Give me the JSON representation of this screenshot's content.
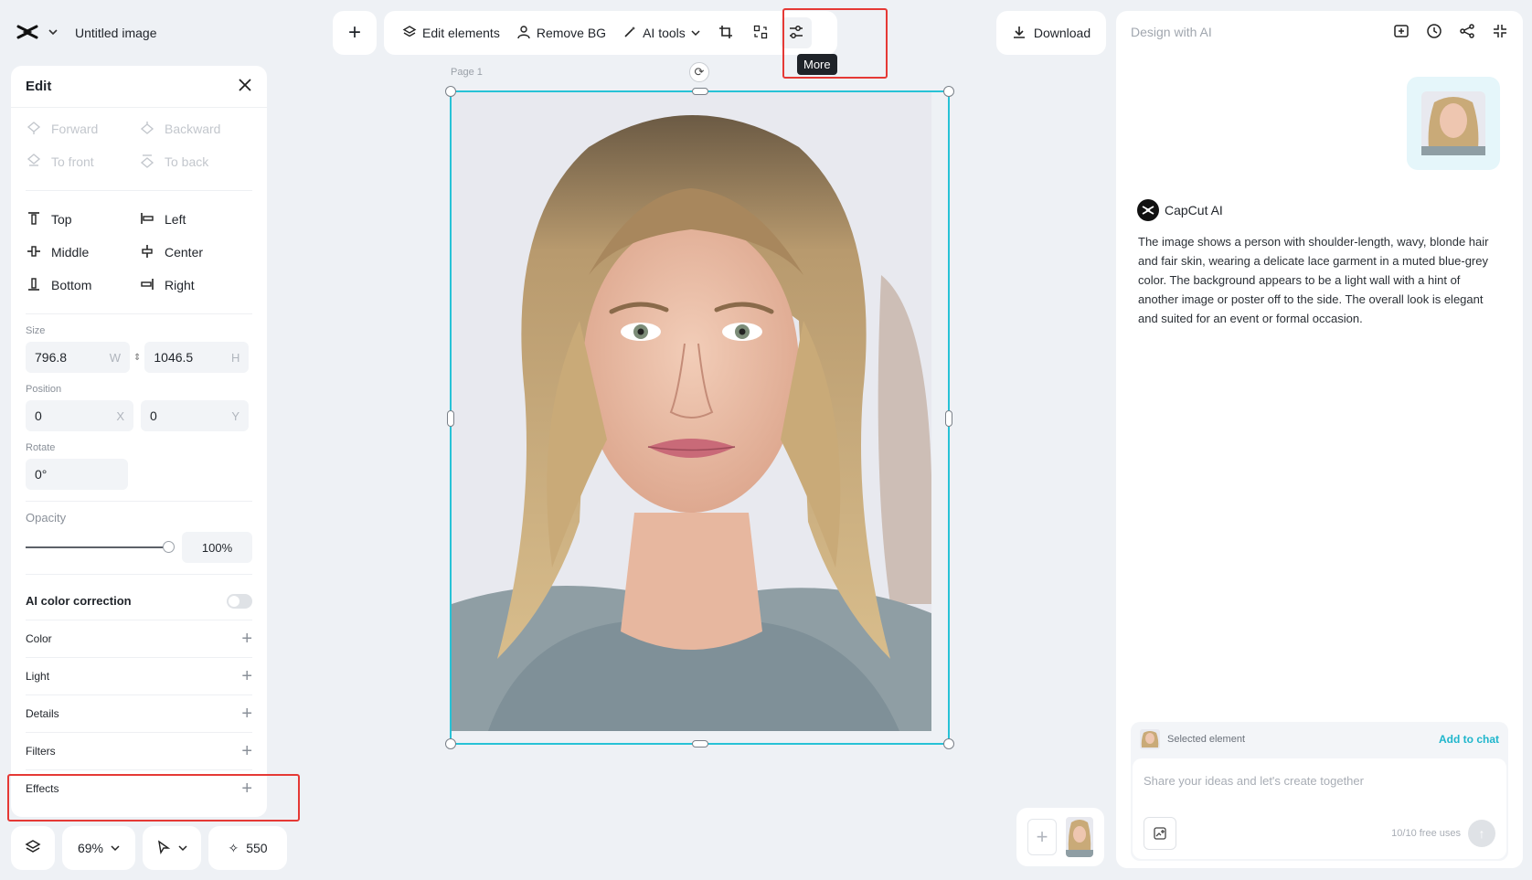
{
  "app": {
    "title": "Untitled image"
  },
  "edit_panel": {
    "title": "Edit",
    "arrange": [
      {
        "label": "Forward",
        "disabled": true
      },
      {
        "label": "Backward",
        "disabled": true
      },
      {
        "label": "To front",
        "disabled": true
      },
      {
        "label": "To back",
        "disabled": true
      }
    ],
    "align": [
      {
        "label": "Top"
      },
      {
        "label": "Left"
      },
      {
        "label": "Middle"
      },
      {
        "label": "Center"
      },
      {
        "label": "Bottom"
      },
      {
        "label": "Right"
      }
    ],
    "size_label": "Size",
    "width": "796.8",
    "width_suffix": "W",
    "height": "1046.5",
    "height_suffix": "H",
    "position_label": "Position",
    "x": "0",
    "x_suffix": "X",
    "y": "0",
    "y_suffix": "Y",
    "rotate_label": "Rotate",
    "rotate": "0°",
    "opacity_label": "Opacity",
    "opacity_value": "100%",
    "opacity_fraction": 1.0,
    "ai_color_correction": "AI color correction",
    "ai_color_correction_on": false,
    "sections": [
      "Color",
      "Light",
      "Details",
      "Filters",
      "Effects"
    ]
  },
  "bottom_bar": {
    "zoom": "69%",
    "credits": "550"
  },
  "toolbar": {
    "edit_elements": "Edit elements",
    "remove_bg": "Remove BG",
    "ai_tools": "AI tools",
    "more_tooltip": "More"
  },
  "download": "Download",
  "canvas": {
    "page_label": "Page 1"
  },
  "ai_panel": {
    "placeholder_title": "Design with AI",
    "bot_name": "CapCut AI",
    "message": "The image shows a person with shoulder-length, wavy, blonde hair and fair skin, wearing a delicate lace garment in a muted blue-grey color. The background appears to be a light wall with a hint of another image or poster off to the side. The overall look is elegant and suited for an event or formal occasion.",
    "selected_element": "Selected element",
    "add_to_chat": "Add to chat",
    "input_placeholder": "Share your ideas and let's create together",
    "free_uses": "10/10 free uses"
  },
  "colors": {
    "accent": "#27c2d6",
    "highlight": "#e53935"
  }
}
